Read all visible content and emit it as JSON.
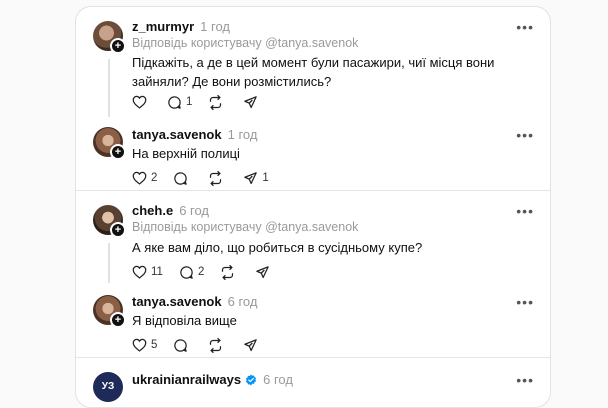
{
  "threads": [
    {
      "comment": {
        "username": "z_murmyr",
        "time": "1 год",
        "reply_to": "Відповідь користувачу @tanya.savenok",
        "text": "Підкажіть, а де в цей момент були пасажири, чиї місця вони зайняли? Де вони розмістились?",
        "likes": "",
        "comments": "1",
        "reposts": "",
        "shares": ""
      },
      "reply": {
        "username": "tanya.savenok",
        "time": "1 год",
        "text": "На верхній полиці",
        "likes": "2",
        "comments": "",
        "reposts": "",
        "shares": "1"
      }
    },
    {
      "comment": {
        "username": "cheh.e",
        "time": "6 год",
        "reply_to": "Відповідь користувачу @tanya.savenok",
        "text": "А яке вам діло, що робиться в сусідньому купе?",
        "likes": "11",
        "comments": "2",
        "reposts": "",
        "shares": ""
      },
      "reply": {
        "username": "tanya.savenok",
        "time": "6 год",
        "text": "Я відповіла вище",
        "likes": "5",
        "comments": "",
        "reposts": "",
        "shares": ""
      }
    }
  ],
  "last_post": {
    "username": "ukrainianrailways",
    "time": "6 год",
    "avatar_text": "УЗ"
  },
  "colors": {
    "verified": "#0095f6",
    "brand_dark": "#1e2a5a"
  }
}
